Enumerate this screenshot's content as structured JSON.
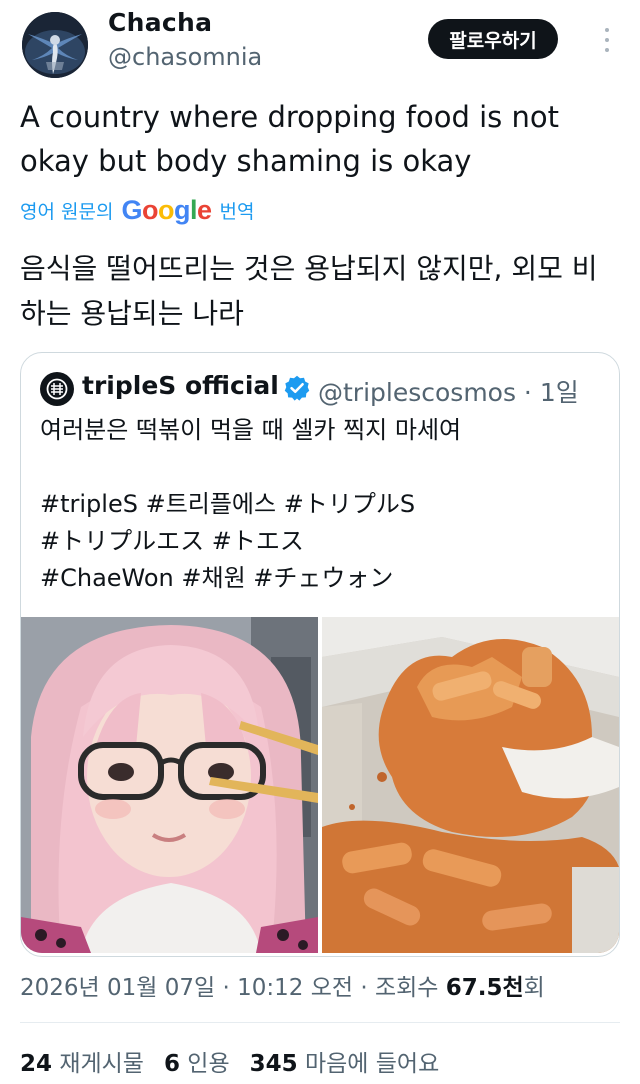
{
  "author": {
    "display_name": "Chacha",
    "handle": "@chasomnia",
    "follow_label": "팔로우하기",
    "avatar_icon": "blue-bird-avatar"
  },
  "tweet": {
    "text": "A country where dropping food is not okay but body shaming is okay",
    "translate_label_prefix": "영어 원문의",
    "translate_brand": "Google",
    "translate_label_suffix": "번역",
    "translated_text": "음식을 떨어뜨리는 것은 용납되지 않지만, 외모 비하는 용납되는 나라"
  },
  "quote": {
    "display_name": "tripleS official",
    "handle_time": "@triplescosmos · 1일",
    "text": "여러분은 떡볶이 먹을 때 셀카 찍지 마세여\n\n#tripleS #트리플에스 #トリプルS\n#トリプルエス #トエス\n#ChaeWon #채원 #チェウォン",
    "images": [
      "selfie-photo",
      "spilled-tteokbokki-photo"
    ]
  },
  "meta": {
    "timestamp": "2026년 01월 07일 · 10:12 오전 · 조회수",
    "views": "67.5천",
    "views_suffix": "회"
  },
  "stats": {
    "reposts_count": "24",
    "reposts_label": "재게시물",
    "quotes_count": "6",
    "quotes_label": "인용",
    "likes_count": "345",
    "likes_label": "마음에 들어요"
  },
  "colors": {
    "accent": "#1d9bf0",
    "text": "#0f1419",
    "muted": "#536471",
    "google_blue": "#4285f4",
    "google_red": "#ea4335",
    "google_yellow": "#fbbc05",
    "google_green": "#34a853"
  }
}
